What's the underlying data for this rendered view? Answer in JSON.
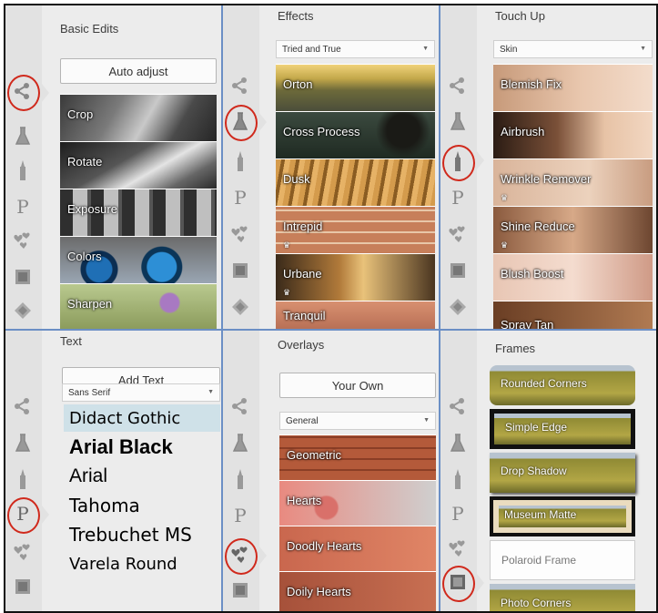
{
  "panels": {
    "basic": {
      "title": "Basic Edits",
      "button": "Auto adjust",
      "tiles": [
        {
          "label": "Crop"
        },
        {
          "label": "Rotate"
        },
        {
          "label": "Exposure"
        },
        {
          "label": "Colors"
        },
        {
          "label": "Sharpen"
        }
      ]
    },
    "effects": {
      "title": "Effects",
      "dropdown": "Tried and True",
      "tiles": [
        {
          "label": "Orton"
        },
        {
          "label": "Cross Process"
        },
        {
          "label": "Dusk"
        },
        {
          "label": "Intrepid",
          "crown": "♛"
        },
        {
          "label": "Urbane",
          "crown": "♛"
        },
        {
          "label": "Tranquil"
        }
      ]
    },
    "touchup": {
      "title": "Touch Up",
      "dropdown": "Skin",
      "tiles": [
        {
          "label": "Blemish Fix"
        },
        {
          "label": "Airbrush"
        },
        {
          "label": "Wrinkle Remover",
          "crown": "♛"
        },
        {
          "label": "Shine Reduce",
          "crown": "♛"
        },
        {
          "label": "Blush Boost"
        },
        {
          "label": "Spray Tan"
        }
      ]
    },
    "text": {
      "title": "Text",
      "button": "Add Text",
      "dropdown": "Sans Serif",
      "fonts": [
        {
          "label": "Didact Gothic"
        },
        {
          "label": "Arial Black"
        },
        {
          "label": "Arial"
        },
        {
          "label": "Tahoma"
        },
        {
          "label": "Trebuchet MS"
        },
        {
          "label": "Varela Round"
        }
      ]
    },
    "overlays": {
      "title": "Overlays",
      "button": "Your Own",
      "dropdown": "General",
      "tiles": [
        {
          "label": "Geometric"
        },
        {
          "label": "Hearts"
        },
        {
          "label": "Doodly Hearts"
        },
        {
          "label": "Doily Hearts"
        }
      ]
    },
    "frames": {
      "title": "Frames",
      "tiles": [
        {
          "label": "Rounded Corners"
        },
        {
          "label": "Simple Edge"
        },
        {
          "label": "Drop Shadow"
        },
        {
          "label": "Museum Matte"
        },
        {
          "label": "Polaroid Frame"
        },
        {
          "label": "Photo Corners"
        }
      ]
    }
  },
  "icons": {
    "crown": "crown-icon"
  },
  "colors": {
    "highlight": "#d0291c",
    "divider": "#6b8fc5",
    "font_selected": "#cfe1e8"
  }
}
